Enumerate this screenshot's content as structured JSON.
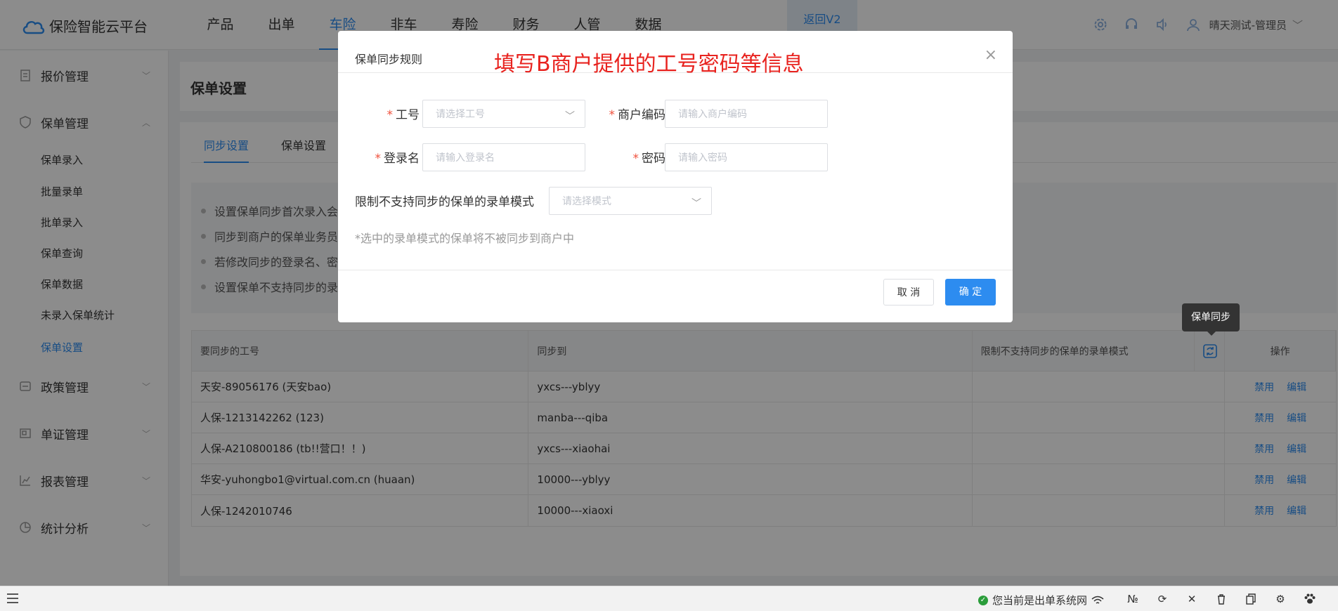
{
  "app": {
    "title": "保险智能云平台"
  },
  "topnav": [
    "产品",
    "出单",
    "车险",
    "非车",
    "寿险",
    "财务",
    "人管",
    "数据"
  ],
  "topnav_active_index": 2,
  "header": {
    "back_v2": "返回V2",
    "user": "晴天测试-管理员"
  },
  "sidebar": {
    "groups": [
      {
        "label": "报价管理",
        "icon": "clipboard-icon"
      },
      {
        "label": "保单管理",
        "icon": "shield-icon",
        "expanded": true
      },
      {
        "label": "政策管理",
        "icon": "policy-icon"
      },
      {
        "label": "单证管理",
        "icon": "document-icon"
      },
      {
        "label": "报表管理",
        "icon": "chart-icon"
      },
      {
        "label": "统计分析",
        "icon": "pie-icon"
      }
    ],
    "items": [
      "保单录入",
      "批量录单",
      "批单录入",
      "保单查询",
      "保单数据",
      "未录入保单统计",
      "保单设置"
    ],
    "active_item": "保单设置"
  },
  "page": {
    "title": "保单设置",
    "tabs": [
      "同步设置",
      "保单设置"
    ],
    "active_tab": "同步设置",
    "notices": [
      "设置保单同步首次录入会",
      "同步到商户的保单业务员",
      "若修改同步的登录名、密",
      "设置保单不支持同步的录"
    ]
  },
  "table": {
    "headers": [
      "要同步的工号",
      "同步到",
      "限制不支持同步的保单的录单模式",
      "操作"
    ],
    "rows": [
      {
        "account": "天安-89056176 (天安bao)",
        "target": "yxcs---yblyy",
        "mode": ""
      },
      {
        "account": "人保-1213142262 (123)",
        "target": "manba---qiba",
        "mode": ""
      },
      {
        "account": "人保-A210800186 (tb!!营口！！)",
        "target": "yxcs---xiaohai",
        "mode": ""
      },
      {
        "account": "华安-yuhongbo1@virtual.com.cn (huaan)",
        "target": "10000---yblyy",
        "mode": ""
      },
      {
        "account": "人保-1242010746",
        "target": "10000---xiaoxi",
        "mode": ""
      }
    ],
    "op_disable": "禁用",
    "op_edit": "编辑",
    "tooltip": "保单同步"
  },
  "modal": {
    "title": "保单同步规则",
    "annotation": "填写B商户提供的工号密码等信息",
    "fields": {
      "account_label": "工号",
      "account_placeholder": "请选择工号",
      "merchant_code_label": "商户编码",
      "merchant_code_placeholder": "请输入商户编码",
      "login_label": "登录名",
      "login_placeholder": "请输入登录名",
      "password_label": "密码",
      "password_placeholder": "请输入密码",
      "mode_label": "限制不支持同步的保单的录单模式",
      "mode_placeholder": "请选择模式"
    },
    "hint": "*选中的录单模式的保单将不被同步到商户中",
    "cancel": "取 消",
    "ok": "确 定"
  },
  "statusbar": {
    "message": "您当前是出单系统网",
    "icons": [
      "wifi-icon",
      "number-icon",
      "refresh-icon",
      "close-icon",
      "trash-icon",
      "copy-icon",
      "gear-icon",
      "paw-icon"
    ]
  },
  "colors": {
    "accent": "#2d8cf0",
    "annotation": "#e8231f",
    "required": "#f0503c"
  }
}
